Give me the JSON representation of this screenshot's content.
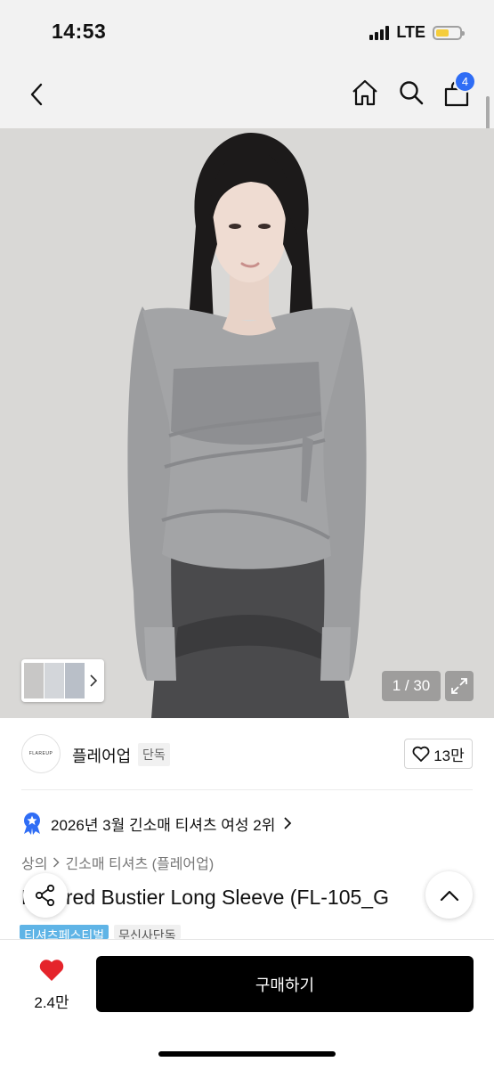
{
  "status": {
    "time": "14:53",
    "network": "LTE",
    "battery_level": 0.55
  },
  "nav": {
    "cart_badge": "4",
    "icons": [
      "back-icon",
      "home-icon",
      "search-icon",
      "cart-icon"
    ]
  },
  "gallery": {
    "pager": "1 / 30"
  },
  "brand": {
    "name": "플레어업",
    "logo_text": "FLAREUP",
    "tag": "단독",
    "likes": "13만"
  },
  "product": {
    "ranking": "2026년 3월 긴소매 티셔츠 여성 2위",
    "breadcrumb": [
      "상의",
      "긴소매 티셔츠 (플레어업)"
    ],
    "title": "Layered Bustier Long Sleeve (FL-105_G",
    "tags": [
      "티셔츠페스티벌",
      "무신사단독"
    ]
  },
  "bottom": {
    "wish_count": "2.4만",
    "buy_label": "구매하기"
  },
  "colors": {
    "accent": "#2f6df5",
    "buy_button": "#000000",
    "heart": "#e5242b"
  }
}
